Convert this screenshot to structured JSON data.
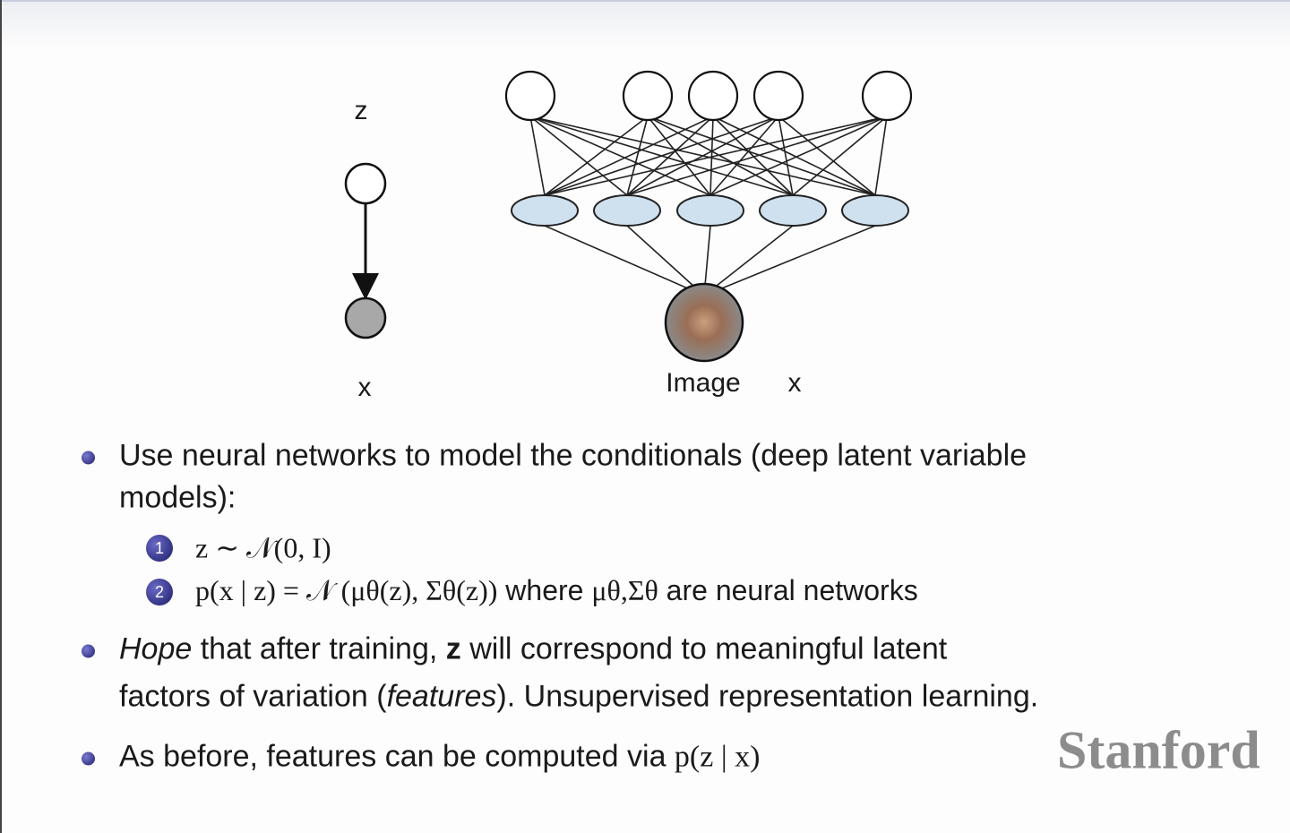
{
  "diagram": {
    "left_model": {
      "latent_label": "z",
      "observed_label": "x"
    },
    "network": {
      "image_label": "Image",
      "x_label": "x",
      "top_nodes": 5,
      "hidden_nodes": 5,
      "hidden_fill": "#cfe0ef"
    }
  },
  "bullets": [
    {
      "line1": "Use neural networks to model the conditionals (deep latent variable",
      "line2": "models):"
    },
    {
      "emph": "Hope",
      "rest1a": " that after training, ",
      "z": "z",
      "rest1b": " will correspond to meaningful latent",
      "line2a": "factors of variation (",
      "line2_emph": "features",
      "line2b": "). Unsupervised representation learning."
    },
    {
      "text": "As before, features can be computed via ",
      "math": "p(z | x)"
    }
  ],
  "subitems": [
    {
      "num": "1",
      "math": "z ∼ 𝒩(0, I)"
    },
    {
      "num": "2",
      "math": "p(x | z) = 𝒩 (μθ(z), Σθ(z))",
      "text_mid": " where ",
      "math2": "μθ,Σθ",
      "text_end": " are neural networks"
    }
  ],
  "watermark": "Stanford",
  "colors": {
    "bullet": "#2a2a80",
    "watermark": "#8c8c8c"
  }
}
